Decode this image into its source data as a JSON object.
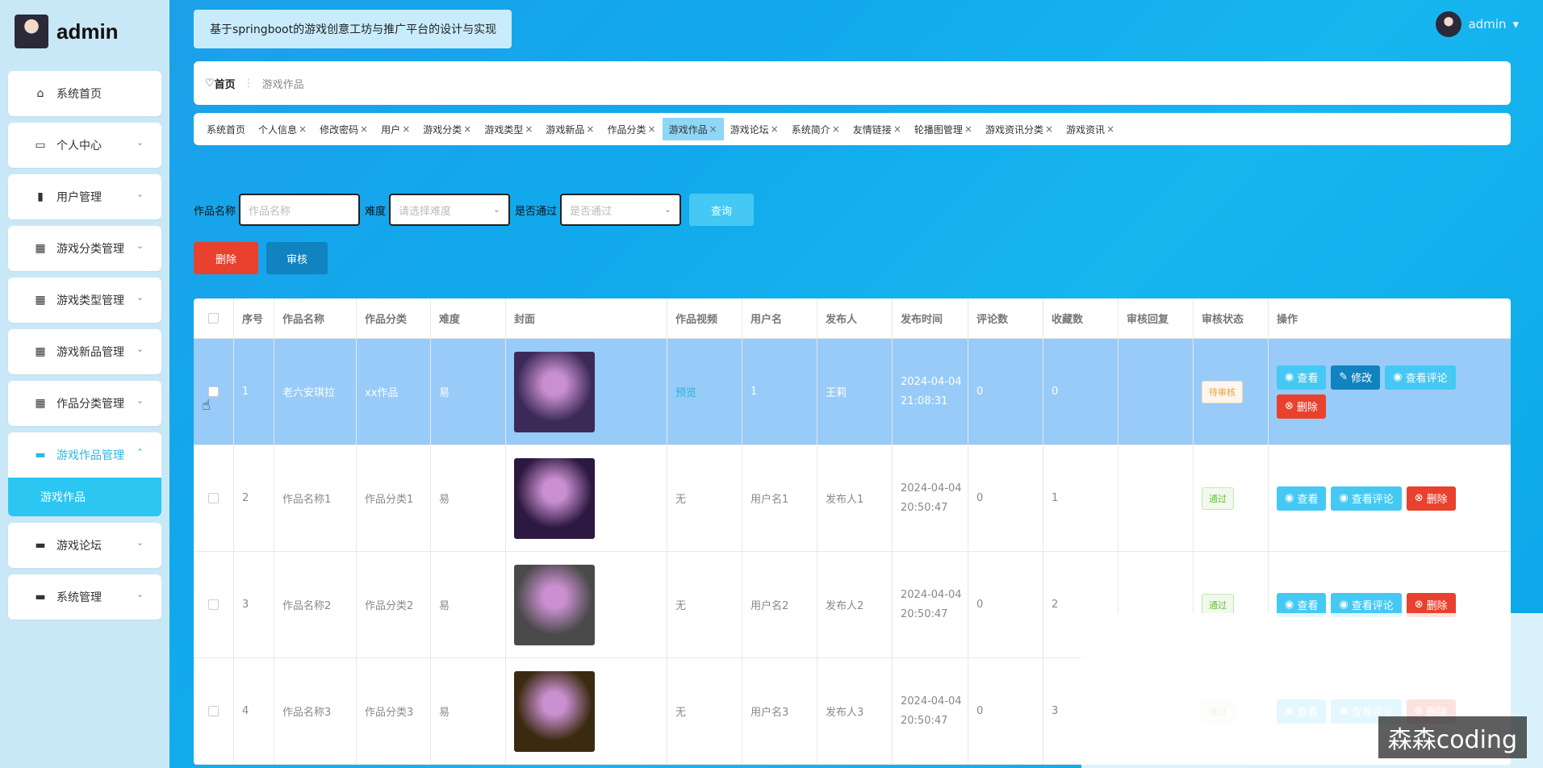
{
  "sidebar": {
    "username": "admin",
    "items": [
      {
        "label": "系统首页",
        "icon": "home-icon",
        "glyph": "⌂"
      },
      {
        "label": "个人中心",
        "icon": "card-icon",
        "glyph": "▭"
      },
      {
        "label": "用户管理",
        "icon": "book-icon",
        "glyph": "▮"
      },
      {
        "label": "游戏分类管理",
        "icon": "grid-icon",
        "glyph": "▦"
      },
      {
        "label": "游戏类型管理",
        "icon": "grid-icon",
        "glyph": "▦"
      },
      {
        "label": "游戏新品管理",
        "icon": "grid-icon",
        "glyph": "▦"
      },
      {
        "label": "作品分类管理",
        "icon": "grid-icon",
        "glyph": "▦"
      },
      {
        "label": "游戏作品管理",
        "icon": "chat-icon",
        "glyph": "▬"
      },
      {
        "label": "游戏论坛",
        "icon": "monitor-icon",
        "glyph": "▬"
      },
      {
        "label": "系统管理",
        "icon": "system-icon",
        "glyph": "▬"
      }
    ],
    "active_sub": "游戏作品"
  },
  "header": {
    "title": "基于springboot的游戏创意工坊与推广平台的设计与实现",
    "user": "admin"
  },
  "breadcrumb": {
    "home": "首页",
    "current": "游戏作品"
  },
  "tags": [
    "系统首页",
    "个人信息",
    "修改密码",
    "用户",
    "游戏分类",
    "游戏类型",
    "游戏新品",
    "作品分类",
    "游戏作品",
    "游戏论坛",
    "系统简介",
    "友情链接",
    "轮播图管理",
    "游戏资讯分类",
    "游戏资讯"
  ],
  "active_tag": "游戏作品",
  "search": {
    "name_label": "作品名称",
    "name_placeholder": "作品名称",
    "difficulty_label": "难度",
    "difficulty_placeholder": "请选择难度",
    "passed_label": "是否通过",
    "passed_placeholder": "是否通过",
    "query_button": "查询"
  },
  "actions": {
    "delete": "删除",
    "audit": "审核"
  },
  "table": {
    "headers": [
      "序号",
      "作品名称",
      "作品分类",
      "难度",
      "封面",
      "作品视频",
      "用户名",
      "发布人",
      "发布时间",
      "评论数",
      "收藏数",
      "审核回复",
      "审核状态",
      "操作"
    ],
    "rows": [
      {
        "idx": "1",
        "name": "老六安琪拉",
        "category": "xx作品",
        "difficulty": "易",
        "video": "预览",
        "username": "1",
        "publisher": "王莉",
        "time": "2024-04-04 21:08:31",
        "comments": "0",
        "favorites": "0",
        "reply": "",
        "status": "待审核",
        "cover": "#3b2a57"
      },
      {
        "idx": "2",
        "name": "作品名称1",
        "category": "作品分类1",
        "difficulty": "易",
        "video": "无",
        "username": "用户名1",
        "publisher": "发布人1",
        "time": "2024-04-04 20:50:47",
        "comments": "0",
        "favorites": "1",
        "reply": "",
        "status": "通过",
        "cover": "#2c1840"
      },
      {
        "idx": "3",
        "name": "作品名称2",
        "category": "作品分类2",
        "difficulty": "易",
        "video": "无",
        "username": "用户名2",
        "publisher": "发布人2",
        "time": "2024-04-04 20:50:47",
        "comments": "0",
        "favorites": "2",
        "reply": "",
        "status": "通过",
        "cover": "#4a4a4a"
      },
      {
        "idx": "4",
        "name": "作品名称3",
        "category": "作品分类3",
        "difficulty": "易",
        "video": "无",
        "username": "用户名3",
        "publisher": "发布人3",
        "time": "2024-04-04 20:50:47",
        "comments": "0",
        "favorites": "3",
        "reply": "",
        "status": "通过",
        "cover": "#3a2a10"
      }
    ],
    "ops": {
      "view": "查看",
      "edit": "修改",
      "comments": "查看评论",
      "delete": "删除"
    }
  },
  "watermark": "森森coding"
}
